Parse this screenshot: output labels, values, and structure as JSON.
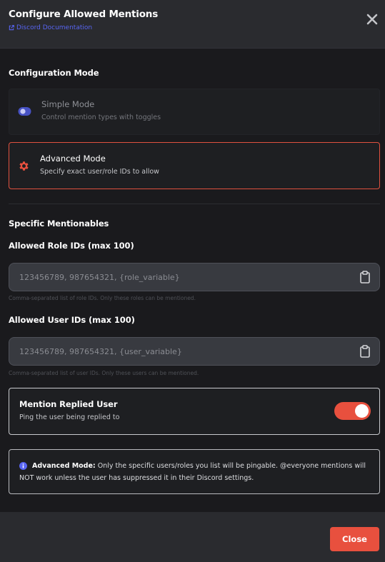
{
  "modal": {
    "title": "Configure Allowed Mentions",
    "doc_link": "Discord Documentation",
    "close_icon": "close-icon"
  },
  "configuration_mode": {
    "heading": "Configuration Mode",
    "modes": [
      {
        "name": "Simple Mode",
        "description": "Control mention types with toggles",
        "icon": "toggle-icon",
        "selected": false
      },
      {
        "name": "Advanced Mode",
        "description": "Specify exact user/role IDs to allow",
        "icon": "gear-icon",
        "selected": true
      }
    ]
  },
  "mentionables": {
    "heading": "Specific Mentionables",
    "role_ids": {
      "label": "Allowed Role IDs (max 100)",
      "value": "",
      "placeholder": "123456789, 987654321, {role_variable}",
      "hint": "Comma-separated list of role IDs. Only these roles can be mentioned.",
      "icon": "clipboard-icon"
    },
    "user_ids": {
      "label": "Allowed User IDs (max 100)",
      "value": "",
      "placeholder": "123456789, 987654321, {user_variable}",
      "hint": "Comma-separated list of user IDs. Only these users can be mentioned.",
      "icon": "clipboard-icon"
    }
  },
  "mention_replied_user": {
    "title": "Mention Replied User",
    "description": "Ping the user being replied to",
    "enabled": true
  },
  "info": {
    "icon": "info-icon",
    "bold": "Advanced Mode:",
    "text": "Only the specific users/roles you list will be pingable. @everyone mentions will NOT work unless the user has suppressed it in their Discord settings."
  },
  "footer": {
    "close_label": "Close"
  },
  "colors": {
    "accent": "#e8503e",
    "link": "#5865f2",
    "toggle_simple": "#4752c4"
  }
}
